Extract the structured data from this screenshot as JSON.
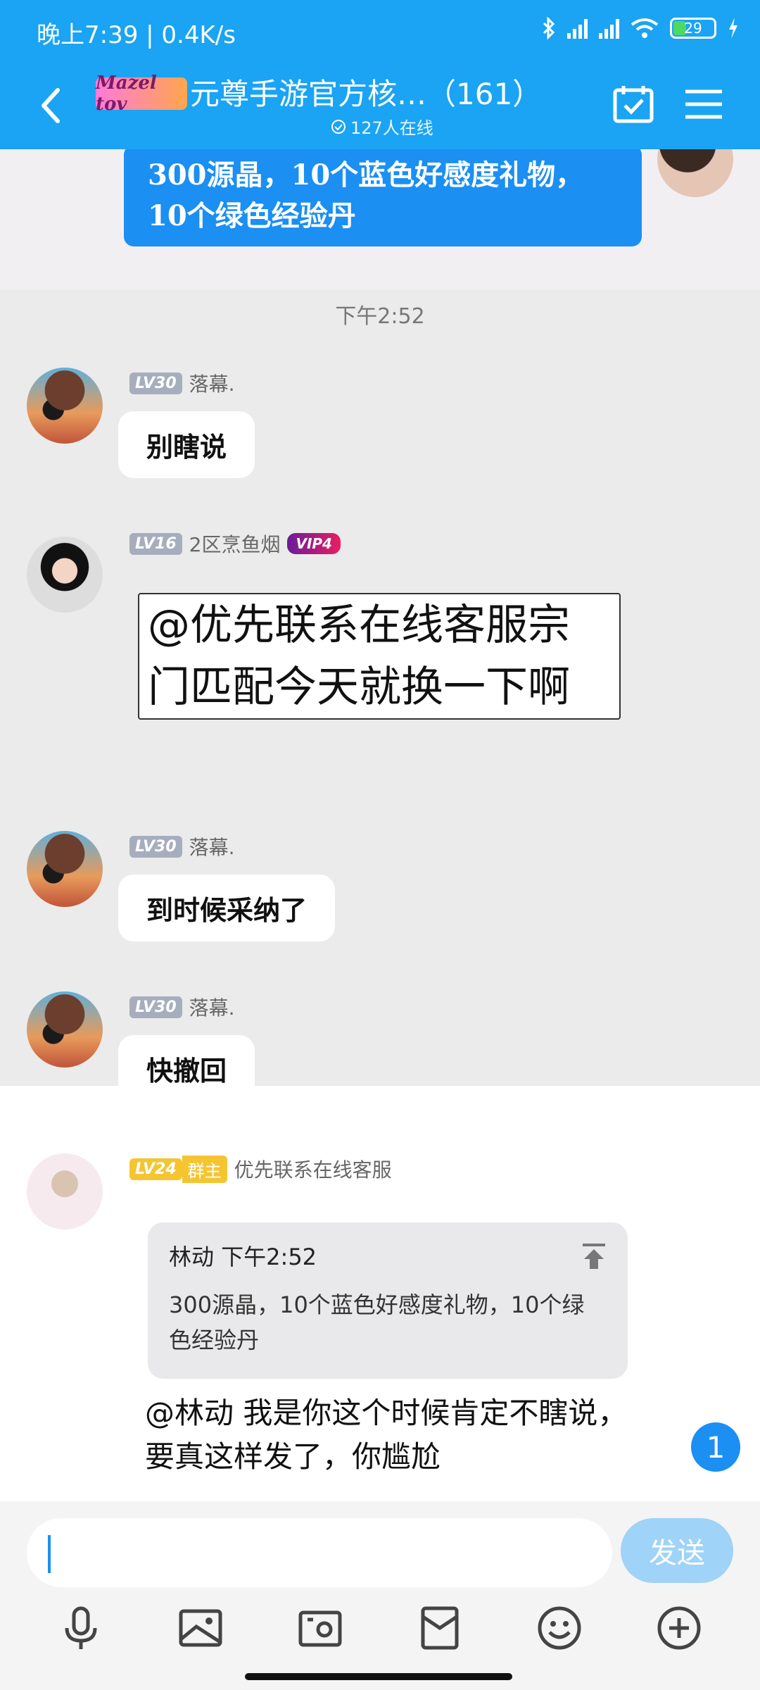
{
  "status": {
    "time_speed": "晚上7:39 | 0.4K/s",
    "battery": "29"
  },
  "header": {
    "logo_text": "Mazel tov",
    "title": "元尊手游官方核…（161）",
    "online": "127人在线"
  },
  "messages": {
    "top_bubble": "300源晶，10个蓝色好感度礼物，10个绿色经验丹",
    "time_sep": "下午2:52",
    "m1": {
      "level": "LV30",
      "name": "落幕.",
      "text": "别瞎说"
    },
    "m2": {
      "level": "LV16",
      "name": "2区烹鱼烟",
      "vip": "VIP4",
      "text": "@优先联系在线客服宗门匹配今天就换一下啊"
    },
    "m3": {
      "level": "LV30",
      "name": "落幕.",
      "text": "到时候采纳了"
    },
    "m4": {
      "level": "LV30",
      "name": "落幕.",
      "text": "快撤回"
    },
    "m5": {
      "level": "LV24",
      "role": "群主",
      "name": "优先联系在线客服",
      "quote_head": "林动 下午2:52",
      "quote_body": "300源晶，10个蓝色好感度礼物，10个绿色经验丹",
      "text": "@林动 我是你这个时候肯定不瞎说，要真这样发了，你尴尬"
    }
  },
  "unread_badge": "1",
  "input": {
    "send_label": "发送"
  },
  "colors": {
    "accent": "#1b8ff2",
    "header": "#1aa4f3"
  }
}
